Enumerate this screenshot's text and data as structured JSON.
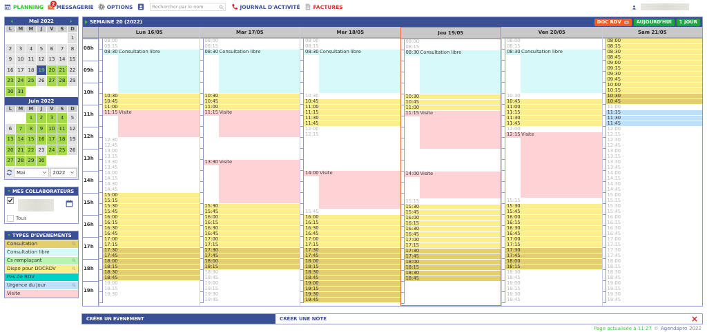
{
  "nav": [
    {
      "kind": "planning",
      "label": "PLANNING",
      "selected": true
    },
    {
      "kind": "messages",
      "label": "MESSAGERIE",
      "badge": "2",
      "selected": false
    },
    {
      "kind": "options",
      "label": "OPTIONS",
      "selected": false
    },
    {
      "kind": "contacts",
      "selected": false
    }
  ],
  "search": {
    "placeholder": "Rechercher par le nom"
  },
  "tools": [
    {
      "kind": "journal",
      "label": "JOURNAL D'ACTIVITÉ"
    },
    {
      "kind": "invoices",
      "label": "FACTURES"
    }
  ],
  "calendars": [
    {
      "title": "Mai 2022",
      "weekdays": [
        "L",
        "M",
        "M",
        "J",
        "V",
        "S",
        "D"
      ],
      "days": [
        {
          "kind": "blank"
        },
        {
          "kind": "blank"
        },
        {
          "kind": "blank"
        },
        {
          "kind": "blank"
        },
        {
          "kind": "blank"
        },
        {
          "kind": "blank"
        },
        {
          "kind": "day",
          "label": "1",
          "available": false,
          "selected": false
        },
        {
          "kind": "day",
          "label": "2",
          "available": false,
          "selected": false
        },
        {
          "kind": "day",
          "label": "3",
          "available": false,
          "selected": false
        },
        {
          "kind": "day",
          "label": "4",
          "available": false,
          "selected": false
        },
        {
          "kind": "day",
          "label": "5",
          "available": false,
          "selected": false
        },
        {
          "kind": "day",
          "label": "6",
          "available": false,
          "selected": false
        },
        {
          "kind": "day",
          "label": "7",
          "available": false,
          "selected": false
        },
        {
          "kind": "day",
          "label": "8",
          "available": false,
          "selected": false
        },
        {
          "kind": "day",
          "label": "9",
          "available": false,
          "selected": false
        },
        {
          "kind": "day",
          "label": "10",
          "available": false,
          "selected": false
        },
        {
          "kind": "day",
          "label": "11",
          "available": false,
          "selected": false
        },
        {
          "kind": "day",
          "label": "12",
          "available": false,
          "selected": false
        },
        {
          "kind": "day",
          "label": "13",
          "available": false,
          "selected": false
        },
        {
          "kind": "day",
          "label": "14",
          "available": false,
          "selected": false
        },
        {
          "kind": "day",
          "label": "15",
          "available": false,
          "selected": false
        },
        {
          "kind": "day",
          "label": "16",
          "available": false,
          "selected": false
        },
        {
          "kind": "day",
          "label": "17",
          "available": false,
          "selected": false
        },
        {
          "kind": "day",
          "label": "18",
          "available": false,
          "selected": false
        },
        {
          "kind": "day",
          "label": "19",
          "available": false,
          "selected": true
        },
        {
          "kind": "day",
          "label": "20",
          "available": true,
          "selected": false
        },
        {
          "kind": "day",
          "label": "21",
          "available": true,
          "selected": false
        },
        {
          "kind": "day",
          "label": "22",
          "available": false,
          "selected": false
        },
        {
          "kind": "day",
          "label": "23",
          "available": true,
          "selected": false
        },
        {
          "kind": "day",
          "label": "24",
          "available": true,
          "selected": false
        },
        {
          "kind": "day",
          "label": "25",
          "available": true,
          "selected": false
        },
        {
          "kind": "day",
          "label": "26",
          "available": false,
          "selected": false
        },
        {
          "kind": "day",
          "label": "27",
          "available": true,
          "selected": false
        },
        {
          "kind": "day",
          "label": "28",
          "available": true,
          "selected": false
        },
        {
          "kind": "day",
          "label": "29",
          "available": false,
          "selected": false
        },
        {
          "kind": "day",
          "label": "30",
          "available": true,
          "selected": false
        },
        {
          "kind": "day",
          "label": "31",
          "available": true,
          "selected": false
        }
      ]
    },
    {
      "title": "Juin 2022",
      "weekdays": [
        "L",
        "M",
        "M",
        "J",
        "V",
        "S",
        "D"
      ],
      "days": [
        {
          "kind": "blank"
        },
        {
          "kind": "blank"
        },
        {
          "kind": "day",
          "label": "1",
          "available": true,
          "selected": false
        },
        {
          "kind": "day",
          "label": "2",
          "available": true,
          "selected": false
        },
        {
          "kind": "day",
          "label": "3",
          "available": true,
          "selected": false
        },
        {
          "kind": "day",
          "label": "4",
          "available": true,
          "selected": false
        },
        {
          "kind": "day",
          "label": "5",
          "available": false,
          "selected": false
        },
        {
          "kind": "day",
          "label": "6",
          "available": false,
          "selected": false
        },
        {
          "kind": "day",
          "label": "7",
          "available": true,
          "selected": false
        },
        {
          "kind": "day",
          "label": "8",
          "available": true,
          "selected": false
        },
        {
          "kind": "day",
          "label": "9",
          "available": true,
          "selected": false
        },
        {
          "kind": "day",
          "label": "10",
          "available": true,
          "selected": false
        },
        {
          "kind": "day",
          "label": "11",
          "available": true,
          "selected": false
        },
        {
          "kind": "day",
          "label": "12",
          "available": false,
          "selected": false
        },
        {
          "kind": "day",
          "label": "13",
          "available": true,
          "selected": false
        },
        {
          "kind": "day",
          "label": "14",
          "available": true,
          "selected": false
        },
        {
          "kind": "day",
          "label": "15",
          "available": true,
          "selected": false
        },
        {
          "kind": "day",
          "label": "16",
          "available": true,
          "selected": false
        },
        {
          "kind": "day",
          "label": "17",
          "available": true,
          "selected": false
        },
        {
          "kind": "day",
          "label": "18",
          "available": true,
          "selected": false
        },
        {
          "kind": "day",
          "label": "19",
          "available": false,
          "selected": false
        },
        {
          "kind": "day",
          "label": "20",
          "available": true,
          "selected": false
        },
        {
          "kind": "day",
          "label": "21",
          "available": true,
          "selected": false
        },
        {
          "kind": "day",
          "label": "22",
          "available": true,
          "selected": false
        },
        {
          "kind": "day",
          "label": "23",
          "available": false,
          "selected": false
        },
        {
          "kind": "day",
          "label": "24",
          "available": true,
          "selected": false
        },
        {
          "kind": "day",
          "label": "25",
          "available": true,
          "selected": false
        },
        {
          "kind": "day",
          "label": "26",
          "available": false,
          "selected": false
        },
        {
          "kind": "day",
          "label": "27",
          "available": true,
          "selected": false
        },
        {
          "kind": "day",
          "label": "28",
          "available": true,
          "selected": false
        },
        {
          "kind": "day",
          "label": "29",
          "available": true,
          "selected": false
        },
        {
          "kind": "day",
          "label": "30",
          "available": true,
          "selected": false
        }
      ]
    }
  ],
  "month_select": {
    "value": "Mai"
  },
  "year_select": {
    "value": "2022"
  },
  "collaborators": {
    "title": "MES COLLABORATEURS",
    "items": [
      {
        "kind": "person",
        "checked": true
      },
      {
        "kind": "all",
        "label": "Tous",
        "checked": false
      }
    ]
  },
  "event_types": {
    "title": "TYPES D'EVENEMENTS",
    "items": [
      {
        "label": "Consultation",
        "color": "#e3cf6c",
        "searchable": true
      },
      {
        "label": "Consultation libre",
        "color": "#d6fafa",
        "searchable": false
      },
      {
        "label": "Cs remplaçant",
        "color": "#b4f5b0",
        "searchable": true
      },
      {
        "label": "Dispo pour DOCRDV",
        "color": "#fbef8b",
        "searchable": true
      },
      {
        "label": "Pas de RDV",
        "color": "#00d2c6",
        "searchable": false
      },
      {
        "label": "Urgence du Jour",
        "color": "#bde0fb",
        "searchable": true
      },
      {
        "label": "Visite",
        "color": "#ffd3d6",
        "searchable": false
      }
    ]
  },
  "week": {
    "title": "SEMAINE 20 (2022)",
    "buttons": [
      {
        "kind": "doc",
        "label": "DOC RDV"
      },
      {
        "kind": "today",
        "label": "AUJOURD'HUI"
      },
      {
        "kind": "day",
        "label": "1 JOUR"
      }
    ]
  },
  "hours": [
    "08h",
    "09h",
    "10h",
    "11h",
    "12h",
    "13h",
    "14h",
    "15h",
    "16h",
    "17h",
    "18h",
    "19h"
  ],
  "days": [
    {
      "label": "Lun 16/05",
      "selected": false,
      "slots": [
        {
          "time": "08:00",
          "kind": "free"
        },
        {
          "time": "08:15",
          "kind": "free"
        },
        {
          "time": "08:30",
          "kind": "libre",
          "label": "Consultation libre"
        },
        {
          "kind": "libre"
        },
        {
          "kind": "libre"
        },
        {
          "kind": "libre"
        },
        {
          "kind": "libre"
        },
        {
          "kind": "libre"
        },
        {
          "kind": "libre"
        },
        {
          "kind": "libre"
        },
        {
          "time": "10:30",
          "kind": "dispo"
        },
        {
          "time": "10:45",
          "kind": "dispo"
        },
        {
          "time": "11:00",
          "kind": "dispo"
        },
        {
          "time": "11:15",
          "kind": "visite",
          "label": "Visite"
        },
        {
          "kind": "visite"
        },
        {
          "kind": "visite"
        },
        {
          "kind": "visite"
        },
        {
          "kind": "visite"
        },
        {
          "time": "12:30",
          "kind": "free"
        },
        {
          "time": "12:45",
          "kind": "free"
        },
        {
          "time": "13:00",
          "kind": "free"
        },
        {
          "time": "13:15",
          "kind": "free"
        },
        {
          "time": "13:30",
          "kind": "free"
        },
        {
          "time": "13:45",
          "kind": "free"
        },
        {
          "time": "14:00",
          "kind": "free"
        },
        {
          "time": "14:15",
          "kind": "free"
        },
        {
          "time": "14:30",
          "kind": "free"
        },
        {
          "time": "14:45",
          "kind": "free"
        },
        {
          "time": "15:00",
          "kind": "dispo"
        },
        {
          "time": "15:15",
          "kind": "dispo"
        },
        {
          "time": "15:30",
          "kind": "dispo"
        },
        {
          "time": "15:45",
          "kind": "dispo"
        },
        {
          "time": "16:00",
          "kind": "dispo"
        },
        {
          "time": "16:15",
          "kind": "dispo"
        },
        {
          "time": "16:30",
          "kind": "dispo"
        },
        {
          "time": "16:45",
          "kind": "dispo"
        },
        {
          "time": "17:00",
          "kind": "dispo"
        },
        {
          "time": "17:15",
          "kind": "dispo"
        },
        {
          "time": "17:30",
          "kind": "consult"
        },
        {
          "time": "17:45",
          "kind": "consult"
        },
        {
          "time": "18:00",
          "kind": "consult"
        },
        {
          "time": "18:15",
          "kind": "consult"
        },
        {
          "time": "18:30",
          "kind": "consult"
        },
        {
          "time": "18:45",
          "kind": "consult"
        },
        {
          "time": "19:00",
          "kind": "free"
        },
        {
          "time": "19:15",
          "kind": "free"
        },
        {
          "time": "19:30",
          "kind": "free"
        },
        {
          "kind": "blank"
        }
      ]
    },
    {
      "label": "Mar 17/05",
      "selected": false,
      "slots": [
        {
          "time": "08:00",
          "kind": "free"
        },
        {
          "time": "08:15",
          "kind": "free"
        },
        {
          "time": "08:30",
          "kind": "libre",
          "label": "Consultation libre"
        },
        {
          "kind": "libre"
        },
        {
          "kind": "libre"
        },
        {
          "kind": "libre"
        },
        {
          "kind": "libre"
        },
        {
          "kind": "libre"
        },
        {
          "kind": "libre"
        },
        {
          "kind": "libre"
        },
        {
          "time": "10:30",
          "kind": "dispo"
        },
        {
          "time": "10:45",
          "kind": "dispo"
        },
        {
          "time": "11:00",
          "kind": "dispo"
        },
        {
          "time": "11:15",
          "kind": "visite",
          "label": "Visite"
        },
        {
          "kind": "visite"
        },
        {
          "kind": "visite"
        },
        {
          "kind": "visite"
        },
        {
          "kind": "visite"
        },
        {
          "kind": "blank"
        },
        {
          "kind": "blank"
        },
        {
          "kind": "blank"
        },
        {
          "kind": "blank"
        },
        {
          "time": "13:30",
          "kind": "visite",
          "label": "Visite"
        },
        {
          "kind": "visite"
        },
        {
          "kind": "visite"
        },
        {
          "kind": "visite"
        },
        {
          "kind": "visite"
        },
        {
          "kind": "visite"
        },
        {
          "kind": "visite"
        },
        {
          "kind": "visite"
        },
        {
          "time": "15:30",
          "kind": "dispo"
        },
        {
          "time": "15:45",
          "kind": "dispo"
        },
        {
          "time": "16:00",
          "kind": "dispo"
        },
        {
          "time": "16:15",
          "kind": "dispo"
        },
        {
          "time": "16:30",
          "kind": "dispo"
        },
        {
          "time": "16:45",
          "kind": "dispo"
        },
        {
          "time": "17:00",
          "kind": "dispo"
        },
        {
          "time": "17:15",
          "kind": "dispo"
        },
        {
          "time": "17:30",
          "kind": "consult"
        },
        {
          "time": "17:45",
          "kind": "consult"
        },
        {
          "time": "18:00",
          "kind": "consult"
        },
        {
          "time": "18:15",
          "kind": "consult"
        },
        {
          "time": "18:30",
          "kind": "free"
        },
        {
          "time": "18:45",
          "kind": "free"
        },
        {
          "time": "19:00",
          "kind": "free"
        },
        {
          "time": "19:15",
          "kind": "free"
        },
        {
          "time": "19:30",
          "kind": "free"
        },
        {
          "time": "19:45",
          "kind": "free"
        }
      ]
    },
    {
      "label": "Mer 18/05",
      "selected": false,
      "slots": [
        {
          "time": "08:00",
          "kind": "free"
        },
        {
          "time": "08:15",
          "kind": "free"
        },
        {
          "time": "08:30",
          "kind": "libre",
          "label": "Consultation libre"
        },
        {
          "kind": "libre"
        },
        {
          "kind": "libre"
        },
        {
          "kind": "libre"
        },
        {
          "kind": "libre"
        },
        {
          "kind": "libre"
        },
        {
          "kind": "libre"
        },
        {
          "kind": "libre"
        },
        {
          "time": "10:30",
          "kind": "free"
        },
        {
          "time": "10:45",
          "kind": "dispo"
        },
        {
          "time": "11:00",
          "kind": "dispo"
        },
        {
          "time": "11:15",
          "kind": "dispo"
        },
        {
          "time": "11:30",
          "kind": "dispo"
        },
        {
          "time": "11:45",
          "kind": "dispo"
        },
        {
          "time": "12:00",
          "kind": "free"
        },
        {
          "time": "12:15",
          "kind": "free"
        },
        {
          "kind": "blank"
        },
        {
          "kind": "blank"
        },
        {
          "kind": "blank"
        },
        {
          "kind": "blank"
        },
        {
          "kind": "blank"
        },
        {
          "kind": "blank"
        },
        {
          "time": "14:00",
          "kind": "visite",
          "label": "Visite"
        },
        {
          "kind": "visite"
        },
        {
          "kind": "visite"
        },
        {
          "kind": "visite"
        },
        {
          "kind": "visite"
        },
        {
          "kind": "visite"
        },
        {
          "kind": "visite"
        },
        {
          "time": "15:45",
          "kind": "free"
        },
        {
          "time": "16:00",
          "kind": "dispo"
        },
        {
          "time": "16:15",
          "kind": "dispo"
        },
        {
          "time": "16:30",
          "kind": "dispo"
        },
        {
          "time": "16:45",
          "kind": "dispo"
        },
        {
          "time": "17:00",
          "kind": "dispo"
        },
        {
          "time": "17:15",
          "kind": "dispo"
        },
        {
          "time": "17:30",
          "kind": "consult"
        },
        {
          "time": "17:45",
          "kind": "consult"
        },
        {
          "time": "18:00",
          "kind": "consult"
        },
        {
          "time": "18:15",
          "kind": "consult"
        },
        {
          "time": "18:30",
          "kind": "consult"
        },
        {
          "time": "18:45",
          "kind": "consult"
        },
        {
          "time": "19:00",
          "kind": "consult"
        },
        {
          "time": "19:15",
          "kind": "consult"
        },
        {
          "time": "19:30",
          "kind": "consult"
        },
        {
          "time": "19:45",
          "kind": "consult"
        }
      ]
    },
    {
      "label": "Jeu 19/05",
      "selected": true,
      "slots": [
        {
          "time": "08:00",
          "kind": "free"
        },
        {
          "time": "08:15",
          "kind": "free"
        },
        {
          "time": "08:30",
          "kind": "libre",
          "label": "Consultation libre"
        },
        {
          "kind": "libre"
        },
        {
          "kind": "libre"
        },
        {
          "kind": "libre"
        },
        {
          "kind": "libre"
        },
        {
          "kind": "libre"
        },
        {
          "kind": "libre"
        },
        {
          "kind": "libre"
        },
        {
          "time": "10:30",
          "kind": "dispo"
        },
        {
          "time": "10:45",
          "kind": "dispo"
        },
        {
          "time": "11:00",
          "kind": "dispo"
        },
        {
          "time": "11:15",
          "kind": "visite",
          "label": "Visite"
        },
        {
          "kind": "visite"
        },
        {
          "kind": "visite"
        },
        {
          "kind": "visite"
        },
        {
          "kind": "visite"
        },
        {
          "kind": "visite"
        },
        {
          "kind": "visite"
        },
        {
          "kind": "blank"
        },
        {
          "kind": "blank"
        },
        {
          "kind": "blank"
        },
        {
          "kind": "blank"
        },
        {
          "time": "14:00",
          "kind": "visite",
          "label": "Visite"
        },
        {
          "kind": "visite"
        },
        {
          "kind": "visite"
        },
        {
          "kind": "visite"
        },
        {
          "kind": "visite"
        },
        {
          "time": "15:15",
          "kind": "free"
        },
        {
          "time": "15:30",
          "kind": "dispo"
        },
        {
          "time": "15:45",
          "kind": "dispo"
        },
        {
          "time": "16:00",
          "kind": "dispo"
        },
        {
          "time": "16:15",
          "kind": "dispo"
        },
        {
          "time": "16:30",
          "kind": "dispo"
        },
        {
          "time": "16:45",
          "kind": "dispo"
        },
        {
          "time": "17:00",
          "kind": "dispo"
        },
        {
          "time": "17:15",
          "kind": "dispo"
        },
        {
          "time": "17:30",
          "kind": "consult"
        },
        {
          "time": "17:45",
          "kind": "consult"
        },
        {
          "time": "18:00",
          "kind": "consult"
        },
        {
          "time": "18:15",
          "kind": "consult"
        },
        {
          "time": "18:30",
          "kind": "consult"
        },
        {
          "time": "18:45",
          "kind": "consult"
        },
        {
          "kind": "blank"
        },
        {
          "kind": "blank"
        },
        {
          "kind": "blank"
        },
        {
          "kind": "blank"
        }
      ]
    },
    {
      "label": "Ven 20/05",
      "selected": false,
      "slots": [
        {
          "time": "08:00",
          "kind": "free"
        },
        {
          "time": "08:15",
          "kind": "free"
        },
        {
          "time": "08:30",
          "kind": "libre",
          "label": "Consultation libre"
        },
        {
          "kind": "libre"
        },
        {
          "kind": "libre"
        },
        {
          "kind": "libre"
        },
        {
          "kind": "libre"
        },
        {
          "kind": "libre"
        },
        {
          "kind": "libre"
        },
        {
          "kind": "libre"
        },
        {
          "time": "10:30",
          "kind": "free"
        },
        {
          "time": "10:45",
          "kind": "dispo"
        },
        {
          "time": "11:00",
          "kind": "dispo"
        },
        {
          "time": "11:15",
          "kind": "dispo"
        },
        {
          "time": "11:30",
          "kind": "dispo"
        },
        {
          "time": "11:45",
          "kind": "dispo"
        },
        {
          "time": "12:00",
          "kind": "free"
        },
        {
          "time": "12:15",
          "kind": "visite",
          "label": "Visite"
        },
        {
          "kind": "visite"
        },
        {
          "kind": "visite"
        },
        {
          "kind": "visite"
        },
        {
          "kind": "visite"
        },
        {
          "kind": "visite"
        },
        {
          "kind": "visite"
        },
        {
          "kind": "visite"
        },
        {
          "kind": "visite"
        },
        {
          "kind": "visite"
        },
        {
          "kind": "visite"
        },
        {
          "kind": "visite"
        },
        {
          "time": "15:15",
          "kind": "free"
        },
        {
          "time": "15:30",
          "kind": "dispo"
        },
        {
          "time": "15:45",
          "kind": "dispo"
        },
        {
          "time": "16:00",
          "kind": "dispo"
        },
        {
          "time": "16:15",
          "kind": "dispo"
        },
        {
          "time": "16:30",
          "kind": "dispo"
        },
        {
          "time": "16:45",
          "kind": "dispo"
        },
        {
          "time": "17:00",
          "kind": "dispo"
        },
        {
          "time": "17:15",
          "kind": "dispo"
        },
        {
          "time": "17:30",
          "kind": "consult"
        },
        {
          "time": "17:45",
          "kind": "consult"
        },
        {
          "time": "18:00",
          "kind": "consult"
        },
        {
          "time": "18:15",
          "kind": "consult"
        },
        {
          "time": "18:30",
          "kind": "free"
        },
        {
          "time": "18:45",
          "kind": "free"
        },
        {
          "time": "19:00",
          "kind": "free"
        },
        {
          "time": "19:15",
          "kind": "free"
        },
        {
          "time": "19:30",
          "kind": "free"
        },
        {
          "time": "19:45",
          "kind": "free"
        }
      ]
    },
    {
      "label": "Sam 21/05",
      "selected": false,
      "slots": [
        {
          "time": "08:00",
          "kind": "dispo"
        },
        {
          "time": "08:15",
          "kind": "dispo"
        },
        {
          "time": "08:30",
          "kind": "dispo"
        },
        {
          "time": "08:45",
          "kind": "dispo"
        },
        {
          "time": "09:00",
          "kind": "dispo"
        },
        {
          "time": "09:15",
          "kind": "dispo"
        },
        {
          "time": "09:30",
          "kind": "dispo"
        },
        {
          "time": "09:45",
          "kind": "dispo"
        },
        {
          "time": "10:00",
          "kind": "dispo"
        },
        {
          "time": "10:15",
          "kind": "dispo"
        },
        {
          "time": "10:30",
          "kind": "consult"
        },
        {
          "time": "10:45",
          "kind": "consult"
        },
        {
          "time": "11:00",
          "kind": "free"
        },
        {
          "time": "11:15",
          "kind": "urgence"
        },
        {
          "time": "11:30",
          "kind": "urgence"
        },
        {
          "time": "11:45",
          "kind": "urgence"
        },
        {
          "time": "12:00",
          "kind": "free"
        },
        {
          "time": "12:15",
          "kind": "free"
        },
        {
          "time": "12:30",
          "kind": "free"
        },
        {
          "time": "12:45",
          "kind": "free"
        },
        {
          "time": "13:00",
          "kind": "free"
        },
        {
          "time": "13:15",
          "kind": "free"
        },
        {
          "time": "13:30",
          "kind": "free"
        },
        {
          "time": "13:45",
          "kind": "free"
        },
        {
          "time": "14:00",
          "kind": "free"
        },
        {
          "time": "14:15",
          "kind": "free"
        },
        {
          "time": "14:30",
          "kind": "free"
        },
        {
          "time": "14:45",
          "kind": "free"
        },
        {
          "time": "15:00",
          "kind": "free"
        },
        {
          "time": "15:15",
          "kind": "free"
        },
        {
          "time": "15:30",
          "kind": "free"
        },
        {
          "time": "15:45",
          "kind": "free"
        },
        {
          "time": "16:00",
          "kind": "free"
        },
        {
          "time": "16:15",
          "kind": "free"
        },
        {
          "time": "16:30",
          "kind": "free"
        },
        {
          "time": "16:45",
          "kind": "free"
        },
        {
          "time": "17:00",
          "kind": "free"
        },
        {
          "time": "17:15",
          "kind": "free"
        },
        {
          "time": "17:30",
          "kind": "free"
        },
        {
          "time": "17:45",
          "kind": "free"
        },
        {
          "time": "18:00",
          "kind": "free"
        },
        {
          "time": "18:15",
          "kind": "free"
        },
        {
          "time": "18:30",
          "kind": "free"
        },
        {
          "time": "18:45",
          "kind": "free"
        },
        {
          "time": "19:00",
          "kind": "free"
        },
        {
          "time": "19:15",
          "kind": "free"
        },
        {
          "time": "19:30",
          "kind": "free"
        },
        {
          "time": "19:45",
          "kind": "free"
        }
      ]
    }
  ],
  "bottom": {
    "create_event": "CRÉER UN EVENEMENT",
    "create_note": "CRÉER UNE NOTE",
    "close": "×"
  },
  "footer": {
    "updated": "Page actualisée à 11:27",
    "copyright": "©",
    "brand": "Agendapro",
    "year": "2022"
  }
}
